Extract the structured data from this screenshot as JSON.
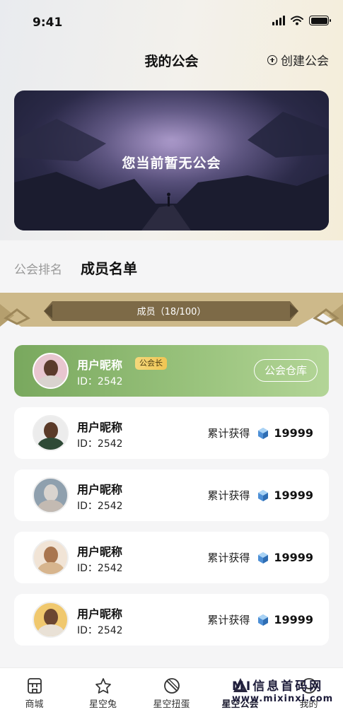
{
  "status_bar": {
    "time": "9:41"
  },
  "header": {
    "title": "我的公会",
    "create_label": "创建公会"
  },
  "banner": {
    "text": "您当前暂无公会"
  },
  "tabs": [
    {
      "label": "公会排名",
      "active": false
    },
    {
      "label": "成员名单",
      "active": true
    }
  ],
  "members_header": {
    "label": "成员（18/100）"
  },
  "leader": {
    "name": "用户昵称",
    "id": "ID：2542",
    "badge": "公会长",
    "button": "公会仓库"
  },
  "members": [
    {
      "name": "用户昵称",
      "id": "ID：2542",
      "earned_label": "累计获得",
      "earned_value": "19999"
    },
    {
      "name": "用户昵称",
      "id": "ID：2542",
      "earned_label": "累计获得",
      "earned_value": "19999"
    },
    {
      "name": "用户昵称",
      "id": "ID：2542",
      "earned_label": "累计获得",
      "earned_value": "19999"
    },
    {
      "name": "用户昵称",
      "id": "ID：2542",
      "earned_label": "累计获得",
      "earned_value": "19999"
    }
  ],
  "tabbar": [
    {
      "label": "商城",
      "icon": "shop-icon"
    },
    {
      "label": "星空兔",
      "icon": "star-rabbit-icon"
    },
    {
      "label": "星空扭蛋",
      "icon": "gacha-icon"
    },
    {
      "label": "星空公会",
      "icon": "guild-icon"
    },
    {
      "label": "我的",
      "icon": "profile-icon"
    }
  ],
  "watermark": {
    "text": "MI信息首码网",
    "url": "www.mixinxi.com"
  },
  "colors": {
    "leader_card": "#8fbb72",
    "badge": "#f2cf64",
    "ribbon": "#8a7750",
    "ribbon_frame": "#cdb98a"
  }
}
